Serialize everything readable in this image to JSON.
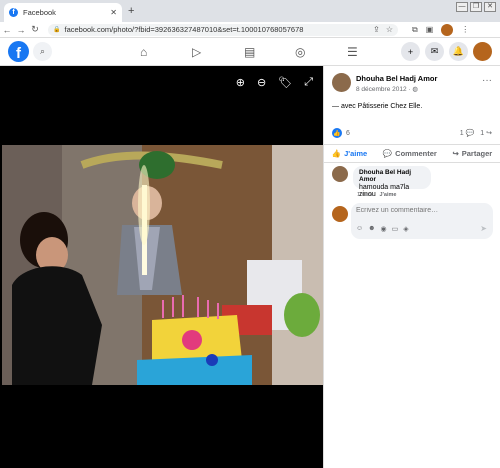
{
  "browser": {
    "tab_title": "Facebook",
    "tab_close": "✕",
    "new_tab": "+",
    "url": "facebook.com/photo/?fbid=392636327487010&set=t.100010768057678",
    "controls": [
      "—",
      "❐",
      "✕"
    ]
  },
  "fb_header": {
    "logo": "f",
    "icons": [
      "search-icon",
      "home-icon",
      "watch-icon",
      "marketplace-icon",
      "groups-icon",
      "menu-icon",
      "create-icon",
      "messenger-icon",
      "notifications-icon"
    ]
  },
  "photo": {
    "tools": [
      "zoom-in-icon",
      "zoom-out-icon",
      "tag-icon",
      "fullscreen-icon"
    ]
  },
  "post": {
    "author": "Dhouha Bel Hadj Amor",
    "date": "8 décembre 2012 · ",
    "with_text": "— avec Pâtisserie Chez Elle.",
    "like_count": "6",
    "comment_count": "1",
    "share_count": "1",
    "actions": {
      "like": "J'aime",
      "comment": "Commenter",
      "share": "Partager"
    }
  },
  "comment": {
    "author": "Dhouha Bel Hadj Amor",
    "text": "hamouda ma7la zinou",
    "age": "10 ans",
    "like": "J'aime"
  },
  "composer": {
    "placeholder": "Écrivez un commentaire…"
  },
  "colors": {
    "facebook_blue": "#1877f2",
    "photo_background": "#000000"
  }
}
